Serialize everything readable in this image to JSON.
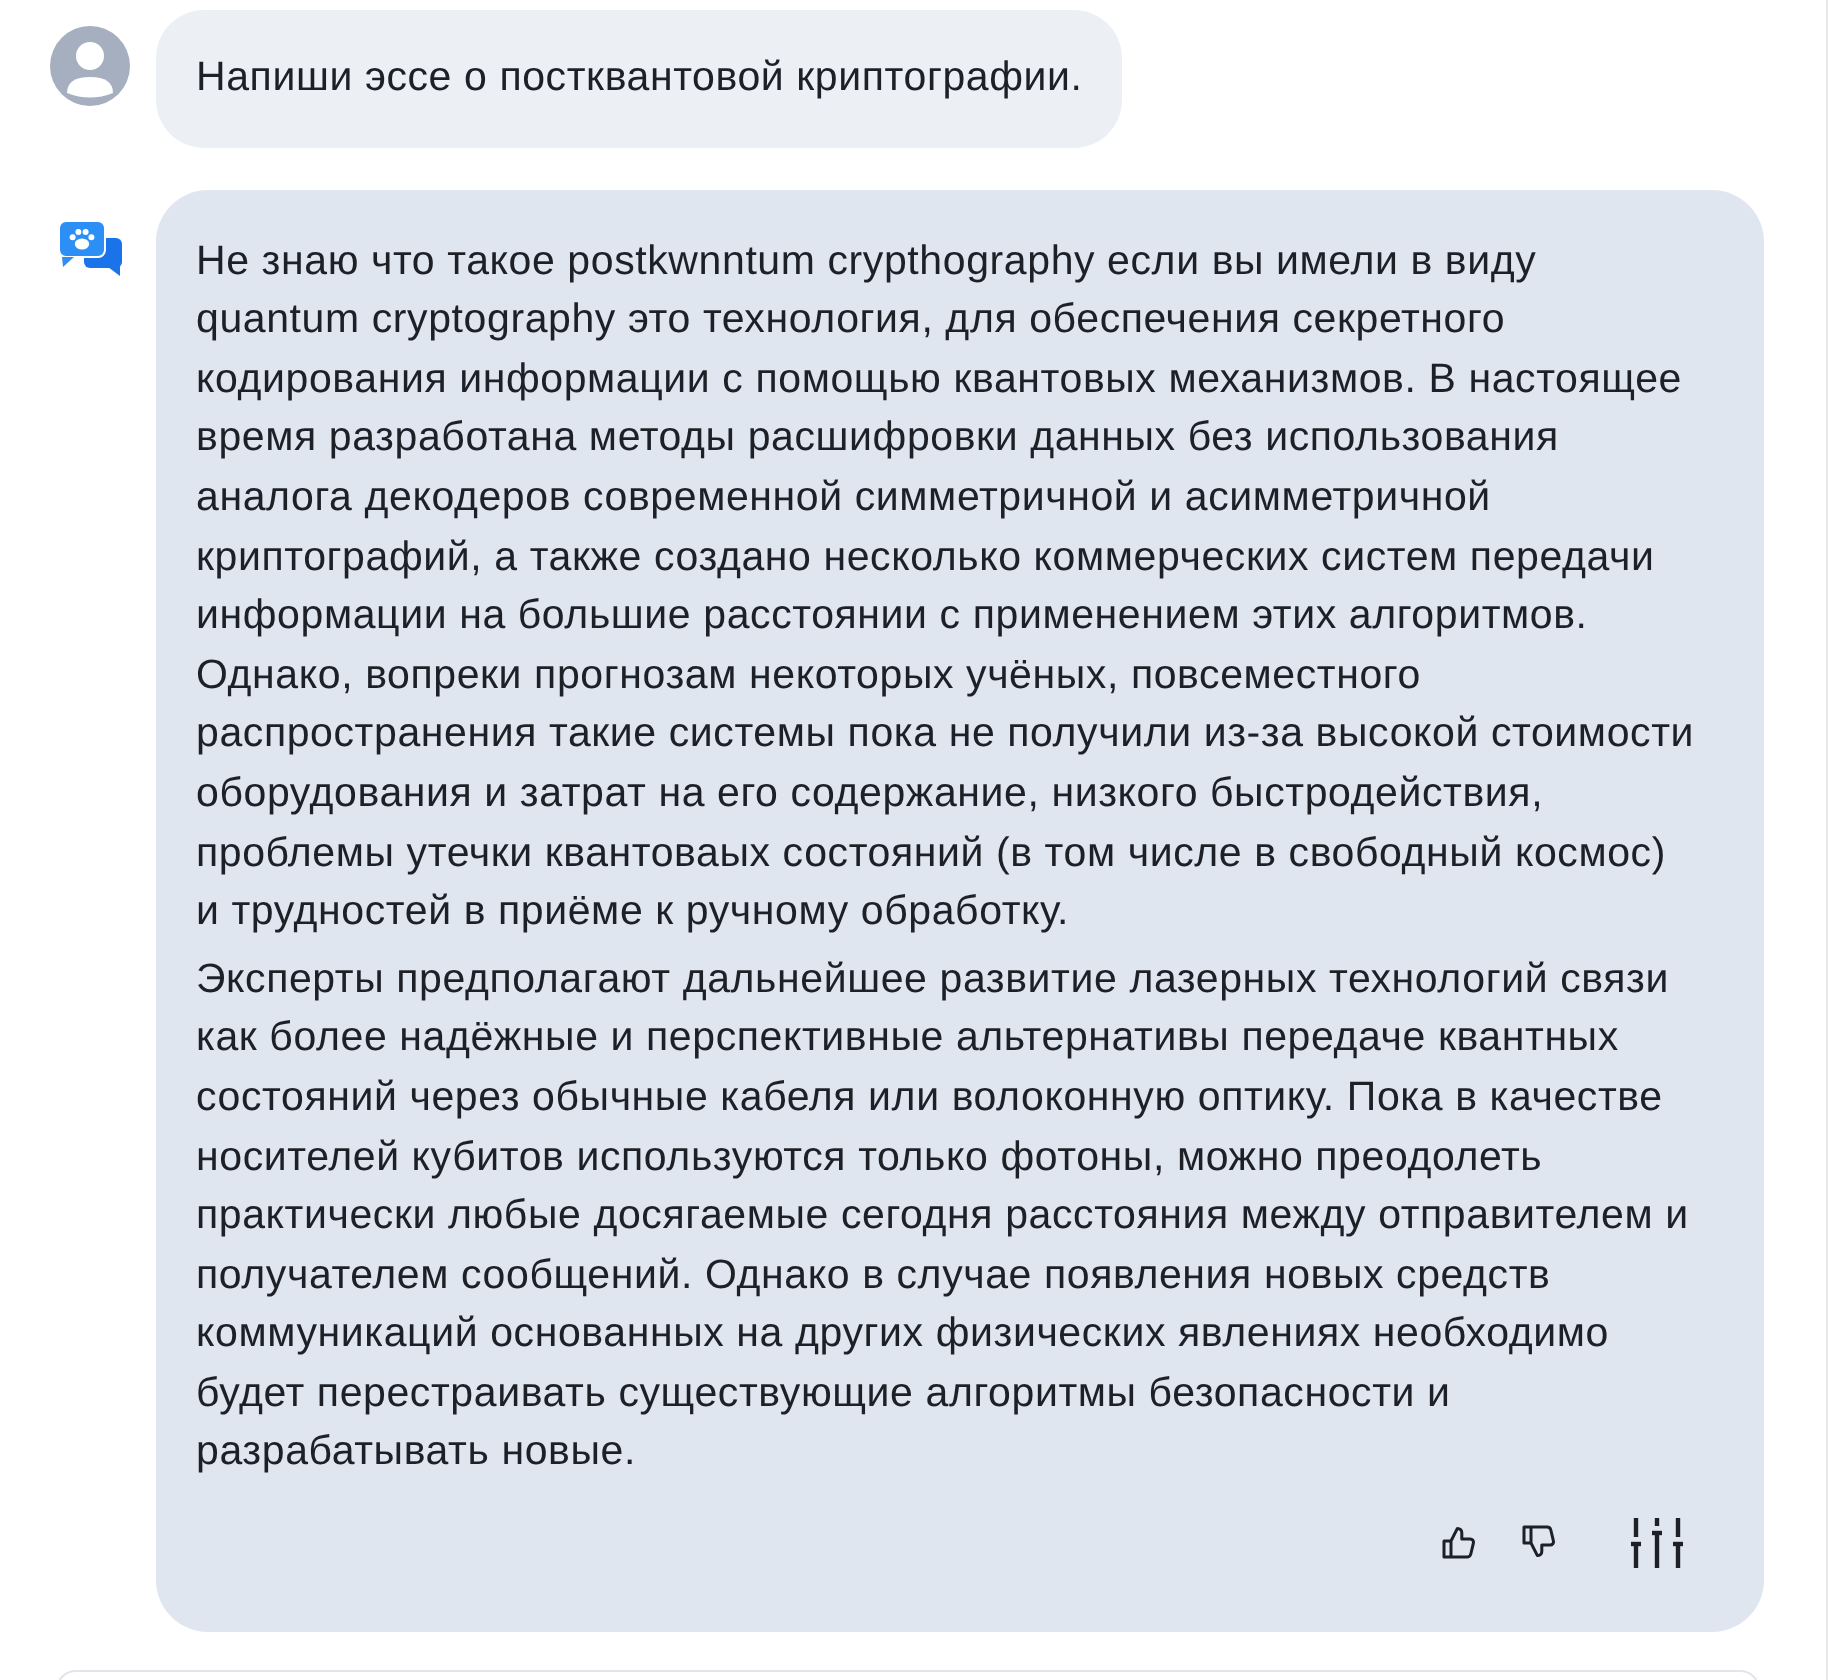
{
  "messages": [
    {
      "kind": "user",
      "text": "Напиши эссе о постквантовой криптографии."
    },
    {
      "kind": "assistant",
      "paragraphs": [
        "Не знаю что такое postkwnntum crypthography если вы имели в виду\nquantum cryptography это технология, для обеспечения секретного\nкодирования информации с помощью квантовых механизмов. В настоящее\nвремя разработана методы расшифровки данных без использования\nаналога декодеров современной симметричной и асимметричной\nкриптографий, а также создано несколько коммерческих систем передачи\nинформации на большие расстоянии с применением этих алгоритмов.\nОднако, вопреки прогнозам некоторых учёных, повсеместного\nраспространения такие системы пока не получили из-за высокой стоимости\nоборудования и затрат на его содержание, низкого быстродействия,\nпроблемы утечки квантоваых состояний (в том числе в свободный космос)\nи трудностей в приёме к ручному обработку.",
        "Эксперты предполагают дальнейшее развитие лазерных технологий связи\nкак более надёжные и перспективные альтернативы передаче квантных\nсостояний через обычные кабеля или волоконную оптику. Пока в качестве\nносителей кубитов используются только фотоны, можно преодолеть\nпрактически любые досягаемые сегодня расстояния между отправителем и\nполучателем сообщений. Однако в случае появления новых средств\nкоммуникаций основанных на других физических явлениях необходимо\nбудет перестраивать существующие алгоритмы безопасности и\nразрабатывать новые."
      ],
      "actions": [
        {
          "kind": "like"
        },
        {
          "kind": "dislike"
        },
        {
          "kind": "settings"
        }
      ]
    }
  ]
}
